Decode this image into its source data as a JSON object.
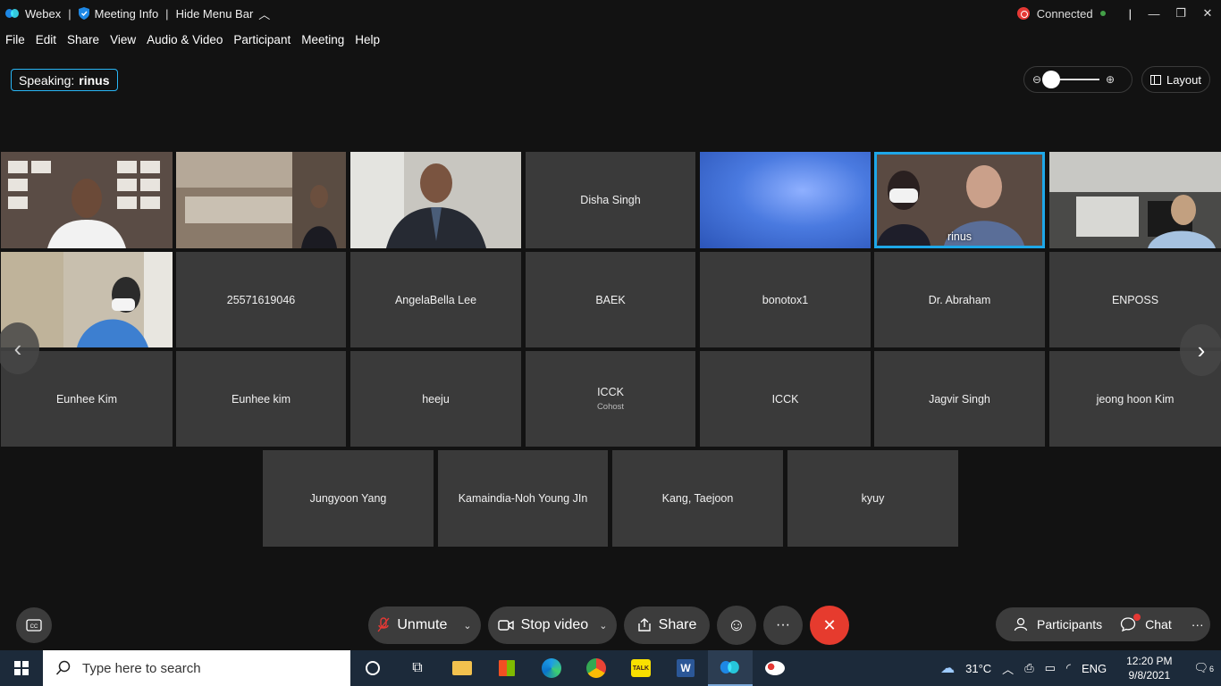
{
  "titlebar": {
    "app_name": "Webex",
    "meeting_info": "Meeting Info",
    "hide_menu": "Hide Menu Bar",
    "status": "Connected"
  },
  "menu": [
    "File",
    "Edit",
    "Share",
    "View",
    "Audio & Video",
    "Participant",
    "Meeting",
    "Help"
  ],
  "speaking": {
    "label": "Speaking:",
    "name": "rinus"
  },
  "layout_label": "Layout",
  "participants_row1": [
    {
      "name": "",
      "video": true
    },
    {
      "name": "",
      "video": true
    },
    {
      "name": "",
      "video": true
    },
    {
      "name": "Disha Singh",
      "video": false
    },
    {
      "name": "",
      "video": true
    },
    {
      "name": "rinus",
      "video": true,
      "active": true
    },
    {
      "name": "",
      "video": true
    }
  ],
  "tiles": {
    "r2": [
      "25571619046",
      "AngelaBella Lee",
      "BAEK",
      "bonotox1",
      "Dr. Abraham",
      "ENPOSS"
    ],
    "r3": [
      "Eunhee Kim",
      "Eunhee kim",
      "heeju",
      "ICCK",
      "ICCK",
      "Jagvir Singh",
      "jeong hoon Kim"
    ],
    "r3_sub": "Cohost",
    "r4": [
      "Jungyoon Yang",
      "Kamaindia-Noh Young JIn",
      "Kang, Taejoon",
      "kyuy"
    ]
  },
  "toolbar": {
    "unmute": "Unmute",
    "stop_video": "Stop video",
    "share": "Share",
    "participants": "Participants",
    "chat": "Chat"
  },
  "taskbar": {
    "search_placeholder": "Type here to search",
    "weather": "31°C",
    "lang": "ENG",
    "time": "12:20 PM",
    "date": "9/8/2021",
    "notif": "6"
  },
  "colors": {
    "accent": "#1ea7e8",
    "end": "#e63b2e",
    "taskbar": "#1c2a3a"
  }
}
